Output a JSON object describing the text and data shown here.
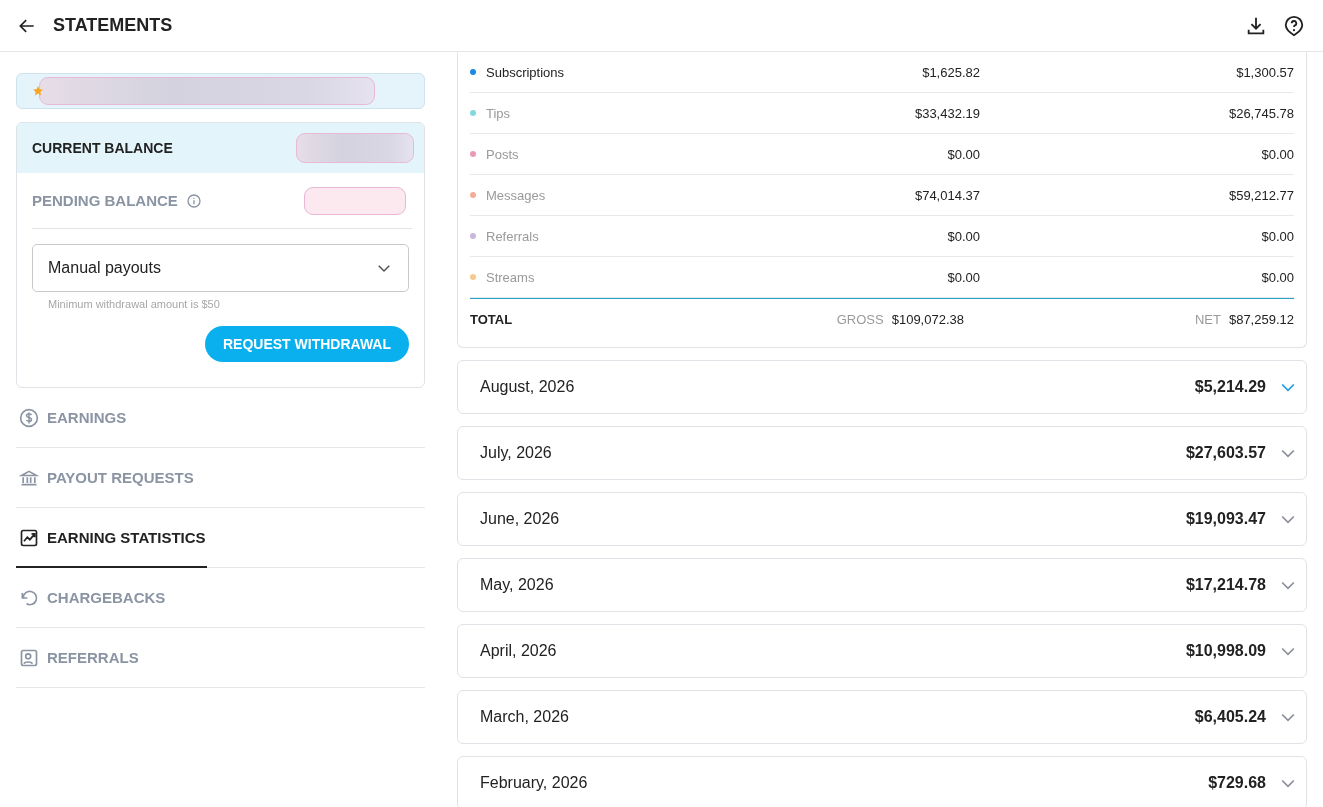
{
  "header": {
    "title": "STATEMENTS"
  },
  "balance": {
    "current_label": "CURRENT BALANCE",
    "pending_label": "PENDING BALANCE",
    "payout_method": "Manual payouts",
    "hint": "Minimum withdrawal amount is $50",
    "button": "REQUEST WITHDRAWAL"
  },
  "nav": [
    {
      "label": "EARNINGS",
      "kind": "dollar",
      "selected": false
    },
    {
      "label": "PAYOUT REQUESTS",
      "kind": "bank",
      "selected": false
    },
    {
      "label": "EARNING STATISTICS",
      "kind": "chart",
      "selected": true
    },
    {
      "label": "CHARGEBACKS",
      "kind": "undo",
      "selected": false
    },
    {
      "label": "REFERRALS",
      "kind": "person",
      "selected": false
    }
  ],
  "breakdown": {
    "rows": [
      {
        "name": "Subscriptions",
        "color": "#1e88e5",
        "highlighted": true,
        "gross": "$1,625.82",
        "net": "$1,300.57"
      },
      {
        "name": "Tips",
        "color": "#80d8e0",
        "highlighted": false,
        "gross": "$33,432.19",
        "net": "$26,745.78"
      },
      {
        "name": "Posts",
        "color": "#ec9ab4",
        "highlighted": false,
        "gross": "$0.00",
        "net": "$0.00"
      },
      {
        "name": "Messages",
        "color": "#f4ab98",
        "highlighted": false,
        "gross": "$74,014.37",
        "net": "$59,212.77"
      },
      {
        "name": "Referrals",
        "color": "#c9b8dc",
        "highlighted": false,
        "gross": "$0.00",
        "net": "$0.00"
      },
      {
        "name": "Streams",
        "color": "#f7c98e",
        "highlighted": false,
        "gross": "$0.00",
        "net": "$0.00"
      }
    ],
    "total_label": "TOTAL",
    "gross_label": "GROSS",
    "gross": "$109,072.38",
    "net_label": "NET",
    "net": "$87,259.12"
  },
  "months": [
    {
      "label": "August, 2026",
      "amount": "$5,214.29",
      "selected": true
    },
    {
      "label": "July, 2026",
      "amount": "$27,603.57",
      "selected": false
    },
    {
      "label": "June, 2026",
      "amount": "$19,093.47",
      "selected": false
    },
    {
      "label": "May, 2026",
      "amount": "$17,214.78",
      "selected": false
    },
    {
      "label": "April, 2026",
      "amount": "$10,998.09",
      "selected": false
    },
    {
      "label": "March, 2026",
      "amount": "$6,405.24",
      "selected": false
    },
    {
      "label": "February, 2026",
      "amount": "$729.68",
      "selected": false
    }
  ]
}
